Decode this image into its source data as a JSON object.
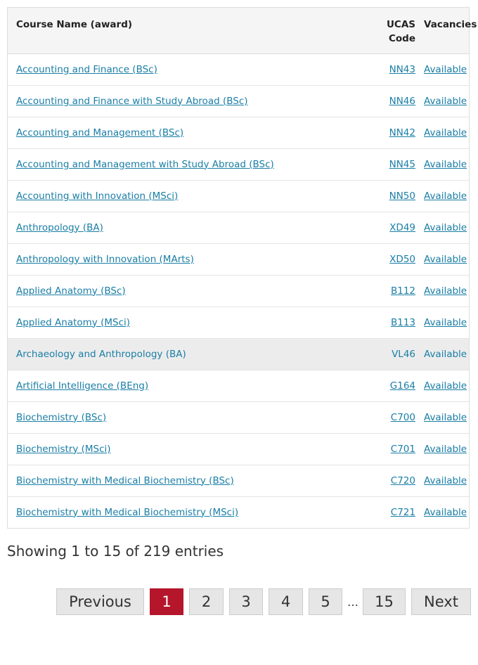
{
  "table": {
    "headers": {
      "name": "Course Name (award)",
      "code_line1": "UCAS",
      "code_line2": "Code",
      "vacancies": "Vacancies"
    },
    "rows": [
      {
        "name": "Accounting and Finance (BSc)",
        "code": "NN43",
        "vacancies": "Available"
      },
      {
        "name": "Accounting and Finance with Study Abroad (BSc)",
        "code": "NN46",
        "vacancies": "Available"
      },
      {
        "name": "Accounting and Management (BSc)",
        "code": "NN42",
        "vacancies": "Available"
      },
      {
        "name": "Accounting and Management with Study Abroad (BSc)",
        "code": "NN45",
        "vacancies": "Available"
      },
      {
        "name": "Accounting with Innovation (MSci)",
        "code": "NN50",
        "vacancies": "Available"
      },
      {
        "name": "Anthropology (BA)",
        "code": "XD49",
        "vacancies": "Available"
      },
      {
        "name": "Anthropology with Innovation (MArts)",
        "code": "XD50",
        "vacancies": "Available"
      },
      {
        "name": "Applied Anatomy (BSc)",
        "code": "B112",
        "vacancies": "Available"
      },
      {
        "name": "Applied Anatomy (MSci)",
        "code": "B113",
        "vacancies": "Available"
      },
      {
        "name": "Archaeology and Anthropology (BA)",
        "code": "VL46",
        "vacancies": "Available"
      },
      {
        "name": "Artificial Intelligence (BEng)",
        "code": "G164",
        "vacancies": "Available"
      },
      {
        "name": "Biochemistry (BSc)",
        "code": "C700",
        "vacancies": "Available"
      },
      {
        "name": "Biochemistry (MSci)",
        "code": "C701",
        "vacancies": "Available"
      },
      {
        "name": "Biochemistry with Medical Biochemistry (BSc)",
        "code": "C720",
        "vacancies": "Available"
      },
      {
        "name": "Biochemistry with Medical Biochemistry (MSci)",
        "code": "C721",
        "vacancies": "Available"
      }
    ]
  },
  "info": "Showing 1 to 15 of 219 entries",
  "pagination": {
    "previous": "Previous",
    "pages": [
      "1",
      "2",
      "3",
      "4",
      "5"
    ],
    "ellipsis": "…",
    "last_page": "15",
    "next": "Next",
    "current": "1"
  },
  "colors": {
    "link": "#1a7ea6",
    "active_page": "#b5162b",
    "header_bg": "#f5f5f5",
    "hover_row_bg": "#ececec"
  }
}
